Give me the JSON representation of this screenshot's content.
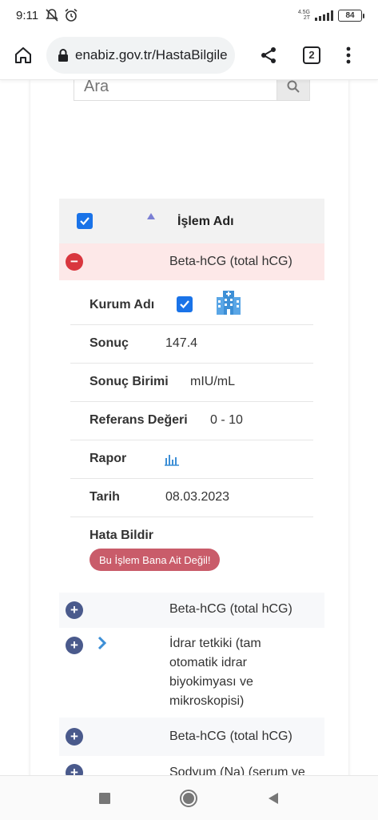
{
  "status": {
    "time": "9:11",
    "network_top": "4.5G",
    "network_bottom": "2T",
    "battery": "84"
  },
  "browser": {
    "url": "enabiz.gov.tr/HastaBilgile",
    "tab_count": "2"
  },
  "search": {
    "placeholder": "Ara"
  },
  "table": {
    "header_label": "İşlem Adı",
    "expanded_row": {
      "title": "Beta-hCG (total hCG)",
      "fields": {
        "kurum_label": "Kurum Adı",
        "sonuc_label": "Sonuç",
        "sonuc_value": "147.4",
        "birim_label": "Sonuç Birimi",
        "birim_value": "mIU/mL",
        "referans_label": "Referans Değeri",
        "referans_value": "0 - 10",
        "rapor_label": "Rapor",
        "tarih_label": "Tarih",
        "tarih_value": "08.03.2023",
        "hata_label": "Hata Bildir",
        "hata_button": "Bu İşlem Bana Ait Değil!"
      }
    },
    "rows": [
      {
        "title": "Beta-hCG (total hCG)"
      },
      {
        "title_lines": [
          "İdrar tetkiki (tam",
          "otomatik idrar",
          "biyokimyası ve",
          "mikroskopisi)"
        ]
      },
      {
        "title": "Beta-hCG (total hCG)"
      },
      {
        "title": "Sodyum (Na) (serum ve"
      }
    ]
  },
  "colors": {
    "expanded_row_bg": "#fde8e8",
    "minus_button": "#d9363e",
    "plus_button": "#4a5a8c",
    "report_button": "#c95c6a",
    "checkbox": "#1a73e8"
  }
}
